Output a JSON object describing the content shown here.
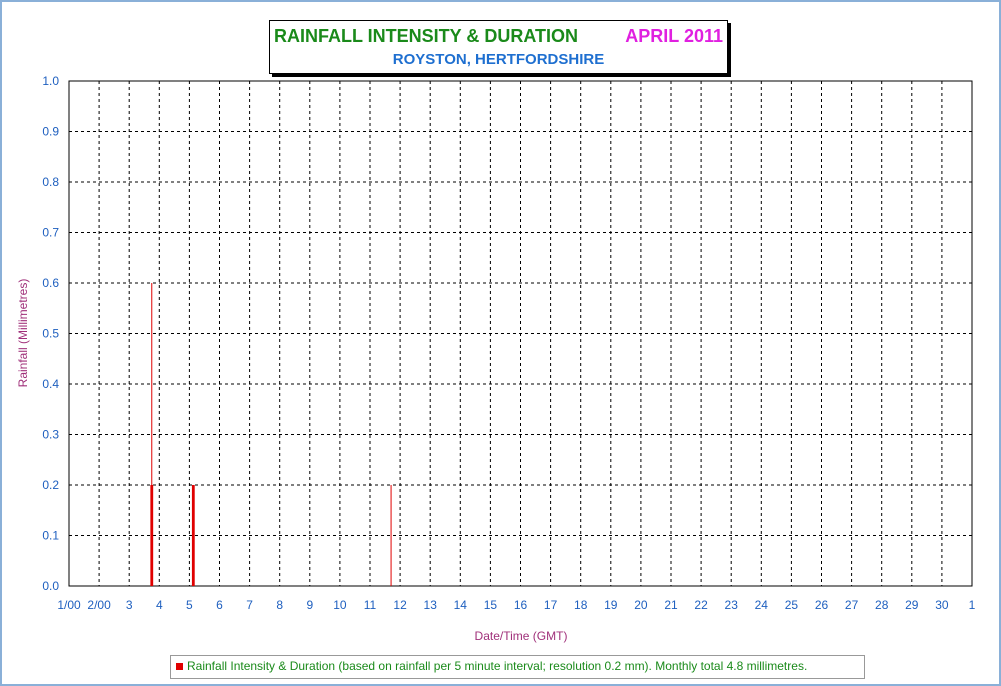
{
  "chart_data": {
    "type": "bar",
    "title": "RAINFALL INTENSITY & DURATION",
    "title_month": "APRIL 2011",
    "subtitle": "ROYSTON, HERTFORDSHIRE",
    "xlabel": "Date/Time (GMT)",
    "ylabel": "Rainfall (Millimetres)",
    "ylim": [
      0,
      1.0
    ],
    "yticks": [
      "0.0",
      "0.1",
      "0.2",
      "0.3",
      "0.4",
      "0.5",
      "0.6",
      "0.7",
      "0.8",
      "0.9",
      "1.0"
    ],
    "xlim": [
      1,
      31
    ],
    "xticks": [
      "1/00",
      "2/00",
      "3",
      "4",
      "5",
      "6",
      "7",
      "8",
      "9",
      "10",
      "11",
      "12",
      "13",
      "14",
      "15",
      "16",
      "17",
      "18",
      "19",
      "20",
      "21",
      "22",
      "23",
      "24",
      "25",
      "26",
      "27",
      "28",
      "29",
      "30",
      "1"
    ],
    "grid": true,
    "legend_position": "bottom",
    "series": [
      {
        "name": "Rainfall Intensity & Duration (based on rainfall per 5 minute interval; resolution 0.2 mm). Monthly total 4.8 millimetres.",
        "color": "#e00000",
        "points": [
          {
            "x": 3.72,
            "y": 0.2
          },
          {
            "x": 3.74,
            "y": 0.2
          },
          {
            "x": 3.75,
            "y": 0.6
          },
          {
            "x": 3.76,
            "y": 0.2
          },
          {
            "x": 3.78,
            "y": 0.2
          },
          {
            "x": 5.1,
            "y": 0.2
          },
          {
            "x": 5.12,
            "y": 0.2
          },
          {
            "x": 5.14,
            "y": 0.2
          },
          {
            "x": 5.16,
            "y": 0.2
          },
          {
            "x": 11.7,
            "y": 0.2
          }
        ]
      }
    ]
  }
}
